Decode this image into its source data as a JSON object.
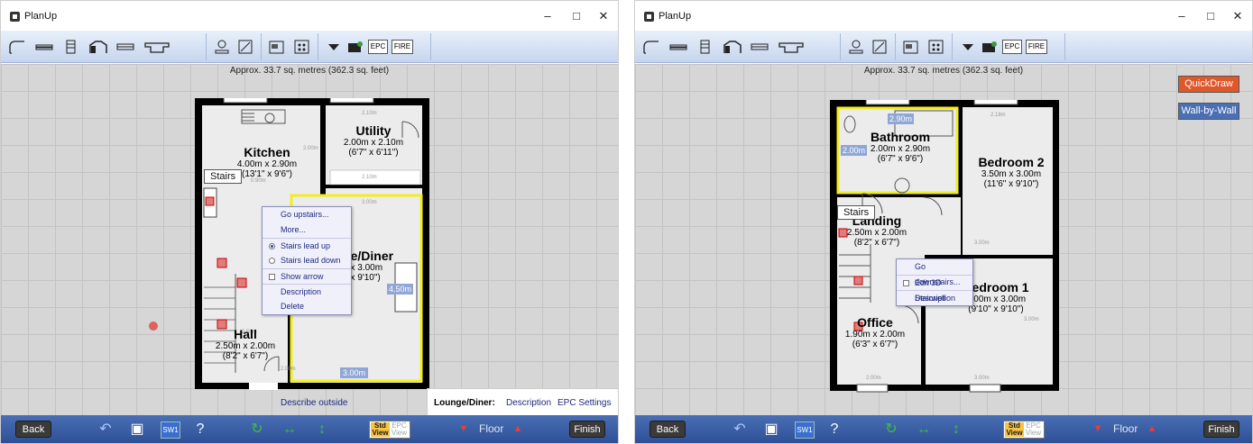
{
  "app": {
    "title": "PlanUp"
  },
  "window_controls": {
    "minimize": "–",
    "maximize": "□",
    "close": "✕"
  },
  "colors": {
    "accent_bottom": "#2d4f95",
    "quickdraw": "#e0572a",
    "wall_by_wall": "#4a6fb5",
    "selected_room": "#f3ec23"
  },
  "toolbar_icons": [
    "wall-icon",
    "window-icon",
    "door-icon",
    "bay-window-icon",
    "radiator-icon",
    "sink-icon",
    "person-icon",
    "pencil-icon",
    "photo-icon",
    "dots-icon",
    "dropdown-icon",
    "camera-icon",
    "epc-icon",
    "fire-icon"
  ],
  "toolbar_labels": {
    "epc": "EPC",
    "fire": "FIRE"
  },
  "area_text": "Approx. 33.7 sq. metres (362.3 sq. feet)",
  "left": {
    "rooms": {
      "kitchen": {
        "name": "Kitchen",
        "dims": "4.00m x 2.90m",
        "imperial": "(13'1\" x 9'6\")"
      },
      "utility": {
        "name": "Utility",
        "dims": "2.00m x 2.10m",
        "imperial": "(6'7\" x 6'11\")"
      },
      "lounge": {
        "name": "Lounge/Diner",
        "dims": "4.00m x 3.00m",
        "imperial": "(13'1\" x 9'10\")",
        "tag": "4.50m",
        "bottom_tag": "3.00m"
      },
      "hall": {
        "name": "Hall",
        "dims": "2.50m x 2.00m",
        "imperial": "(8'2\" x 6'7\")"
      }
    },
    "stairs_label": "Stairs",
    "context_menu": [
      "Go upstairs...",
      "More...",
      "Stairs lead up",
      "Stairs lead down",
      "Show arrow",
      "Description",
      "Delete"
    ],
    "describe_outside": "Describe outside",
    "lounge_bar": {
      "label": "Lounge/Diner:",
      "description": "Description",
      "epc": "EPC Settings"
    }
  },
  "right": {
    "rooms": {
      "bathroom": {
        "name": "Bathroom",
        "dims": "2.00m x 2.90m",
        "imperial": "(6'7\" x 9'6\")",
        "tag1": "2.90m",
        "tag2": "2.00m"
      },
      "bedroom2": {
        "name": "Bedroom 2",
        "dims": "3.50m x 3.00m",
        "imperial": "(11'6\" x 9'10\")"
      },
      "landing": {
        "name": "Landing",
        "dims": "2.50m x 2.00m",
        "imperial": "(8'2\" x 6'7\")"
      },
      "bedroom1": {
        "name": "Bedroom 1",
        "dims": "3.00m x 3.00m",
        "imperial": "(9'10\" x 9'10\")"
      },
      "office": {
        "name": "Office",
        "dims": "1.90m x 2.00m",
        "imperial": "(6'3\" x 6'7\")"
      }
    },
    "stairs_label": "Stairs",
    "context_menu": [
      "Go downstairs...",
      "Edit 3D Stairwell",
      "Description"
    ],
    "quickdraw": "QuickDraw",
    "wall_by_wall": "Wall-by-Wall"
  },
  "bottom": {
    "back": "Back",
    "finish": "Finish",
    "floor": "Floor",
    "std": "Std View",
    "epc_view": "EPC View",
    "sw": "SW1"
  }
}
